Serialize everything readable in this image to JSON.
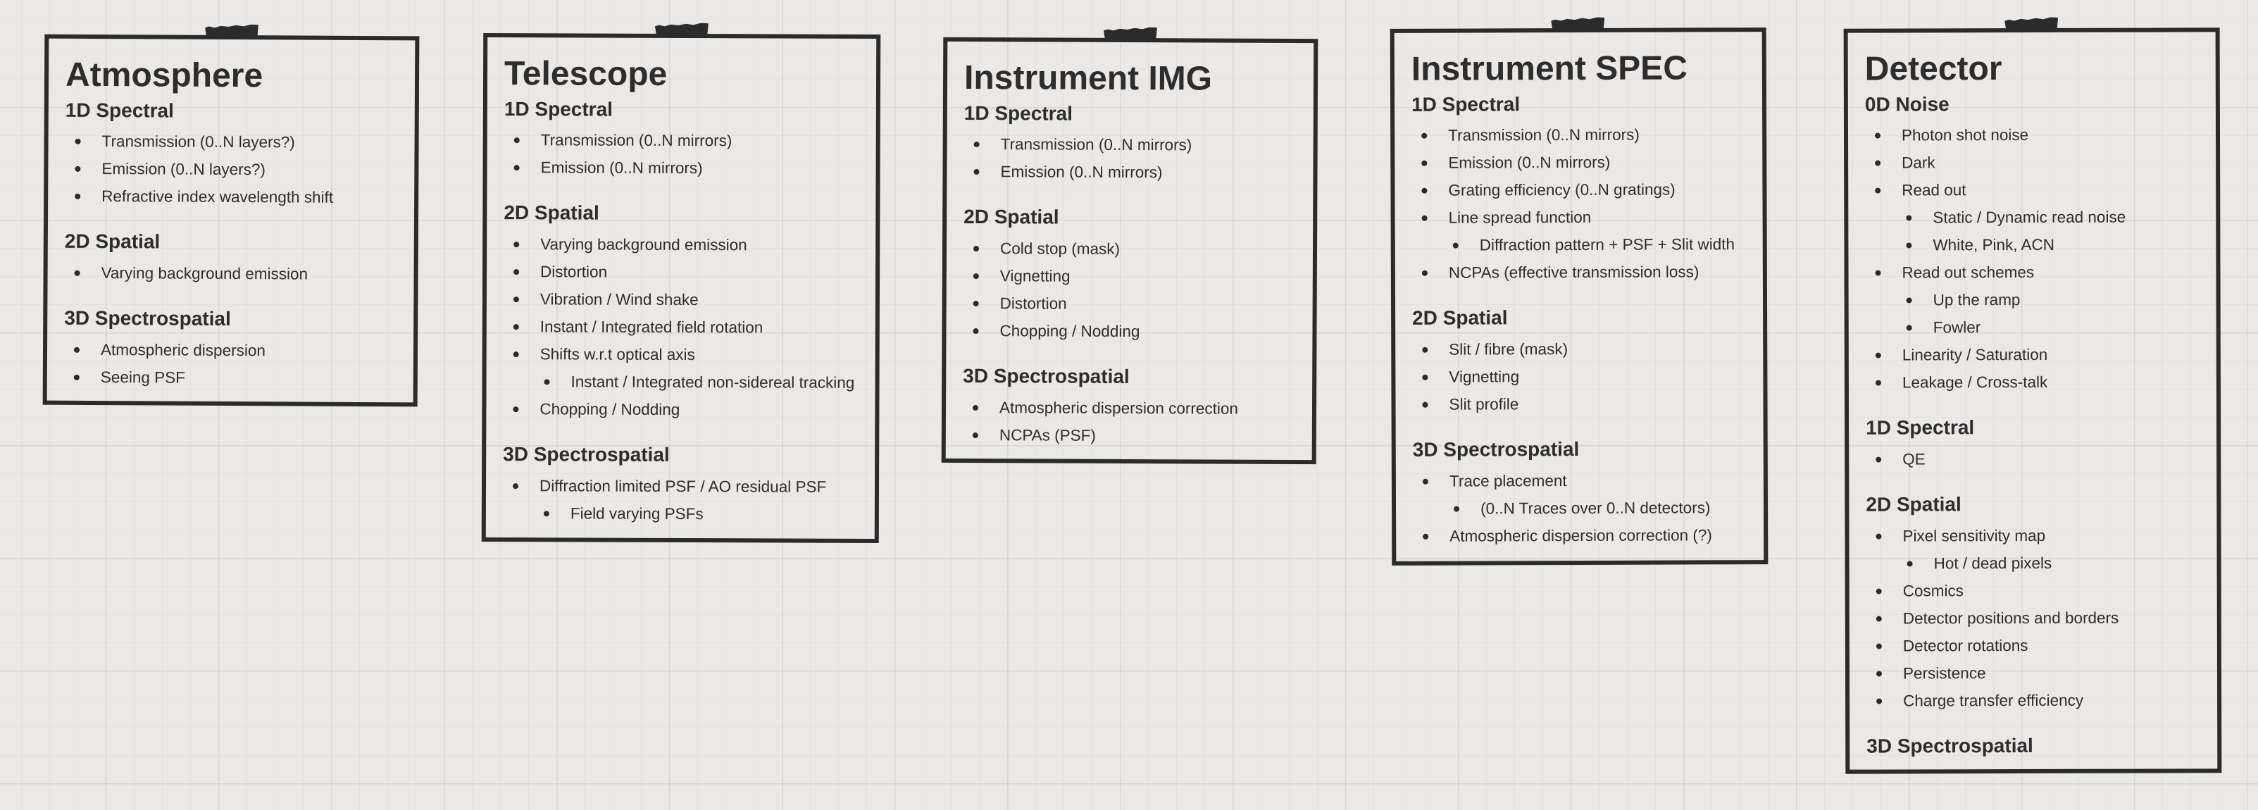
{
  "cards": [
    {
      "title": "Atmosphere",
      "sections": [
        {
          "title": "1D Spectral",
          "items": [
            "Transmission (0..N layers?)",
            "Emission (0..N layers?)",
            "Refractive index wavelength shift"
          ]
        },
        {
          "title": "2D Spatial",
          "items": [
            "Varying background emission"
          ]
        },
        {
          "title": "3D Spectrospatial",
          "items": [
            "Atmospheric dispersion",
            "Seeing PSF"
          ]
        }
      ]
    },
    {
      "title": "Telescope",
      "sections": [
        {
          "title": "1D Spectral",
          "items": [
            "Transmission (0..N mirrors)",
            "Emission (0..N mirrors)"
          ]
        },
        {
          "title": "2D Spatial",
          "items": [
            "Varying background emission",
            "Distortion",
            "Vibration / Wind shake",
            "Instant / Integrated field rotation",
            "Shifts w.r.t optical axis",
            "Instant / Integrated non-sidereal tracking",
            "Chopping / Nodding"
          ]
        },
        {
          "title": "3D Spectrospatial",
          "items": [
            "Diffraction limited PSF / AO residual PSF",
            "Field varying PSFs"
          ]
        }
      ]
    },
    {
      "title": "Instrument IMG",
      "sections": [
        {
          "title": "1D Spectral",
          "items": [
            "Transmission (0..N mirrors)",
            "Emission (0..N mirrors)"
          ]
        },
        {
          "title": "2D Spatial",
          "items": [
            "Cold stop (mask)",
            "Vignetting",
            "Distortion",
            "Chopping / Nodding"
          ]
        },
        {
          "title": "3D Spectrospatial",
          "items": [
            "Atmospheric dispersion correction",
            "NCPAs (PSF)"
          ]
        }
      ]
    },
    {
      "title": "Instrument SPEC",
      "sections": [
        {
          "title": "1D Spectral",
          "items": [
            "Transmission (0..N mirrors)",
            "Emission (0..N mirrors)",
            "Grating efficiency (0..N gratings)",
            "Line spread function",
            "Diffraction pattern + PSF + Slit width",
            "NCPAs (effective transmission loss)"
          ]
        },
        {
          "title": "2D Spatial",
          "items": [
            "Slit / fibre (mask)",
            "Vignetting",
            "Slit profile"
          ]
        },
        {
          "title": "3D Spectrospatial",
          "items": [
            "Trace placement",
            "(0..N Traces over 0..N detectors)",
            "Atmospheric dispersion correction (?)"
          ]
        }
      ]
    },
    {
      "title": "Detector",
      "sections": [
        {
          "title": "0D Noise",
          "items": [
            "Photon shot noise",
            "Dark",
            "Read out",
            "Static / Dynamic read noise",
            "White, Pink, ACN",
            "Read out schemes",
            "Up the ramp",
            "Fowler",
            "Linearity / Saturation",
            "Leakage / Cross-talk"
          ]
        },
        {
          "title": "1D Spectral",
          "items": [
            "QE"
          ]
        },
        {
          "title": "2D Spatial",
          "items": [
            "Pixel sensitivity map",
            "Hot / dead pixels",
            "Cosmics",
            "Detector positions and borders",
            "Detector rotations",
            "Persistence",
            "Charge transfer efficiency"
          ]
        },
        {
          "title": "3D Spectrospatial",
          "items": []
        }
      ]
    }
  ]
}
